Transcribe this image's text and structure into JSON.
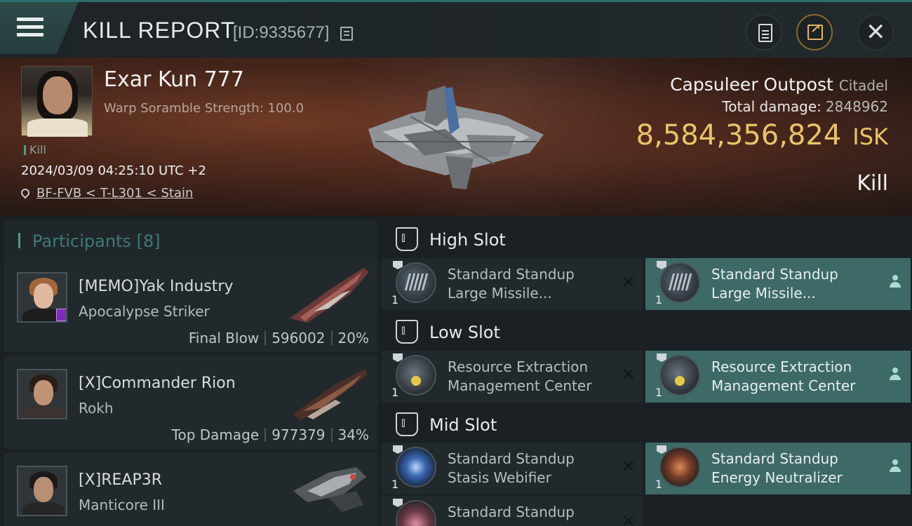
{
  "header": {
    "title": "KILL REPORT",
    "report_id": "[ID:9335677]"
  },
  "victim": {
    "name": "Exar Kun 777",
    "warp_scramble": "Warp Soramble Strength: 100.0",
    "tag": "Kill",
    "timestamp": "2024/03/09 04:25:10 UTC +2",
    "location": "BF-FVB < T-L301 < Stain",
    "structure_name": "Capsuleer Outpost",
    "structure_class": "Citadel",
    "total_damage_label": "Total damage:",
    "total_damage_value": "2848962",
    "isk_value": "8,584,356,824",
    "isk_unit": "ISK",
    "result": "Kill"
  },
  "participants": {
    "title": "Participants",
    "count": "[8]",
    "items": [
      {
        "name": "[MEMO]Yak Industry",
        "ship": "Apocalypse Striker",
        "role": "Final Blow",
        "damage": "596002",
        "percent": "20%"
      },
      {
        "name": "[X]Commander Rion",
        "ship": "Rokh",
        "role": "Top Damage",
        "damage": "977379",
        "percent": "34%"
      },
      {
        "name": "[X]REAP3R",
        "ship": "Manticore III"
      }
    ]
  },
  "slots": {
    "high": {
      "label": "High Slot",
      "left": {
        "qty": "1",
        "line1": "Standard Standup",
        "line2": "Large Missile..."
      },
      "right": {
        "qty": "1",
        "line1": "Standard Standup",
        "line2": "Large Missile..."
      }
    },
    "low": {
      "label": "Low Slot",
      "left": {
        "qty": "1",
        "line1": "Resource Extraction",
        "line2": "Management Center"
      },
      "right": {
        "qty": "1",
        "line1": "Resource Extraction",
        "line2": "Management Center"
      }
    },
    "mid": {
      "label": "Mid Slot",
      "left": {
        "qty": "1",
        "line1": "Standard Standup",
        "line2": "Stasis Webifier"
      },
      "right": {
        "qty": "1",
        "line1": "Standard Standup",
        "line2": "Energy Neutralizer"
      },
      "left2": {
        "line1": "Standard Standup"
      }
    }
  },
  "icons": {
    "menu": "hamburger-icon",
    "copy": "copy-icon",
    "clipboard": "clipboard-icon",
    "share": "share-icon",
    "close": "close-icon",
    "location": "pin-icon",
    "dropped": "x-icon",
    "owner": "person-icon"
  },
  "colors": {
    "accent": "#4f9a8a",
    "isk": "#e8c36a",
    "dropped_bg": "#3d6a66"
  }
}
